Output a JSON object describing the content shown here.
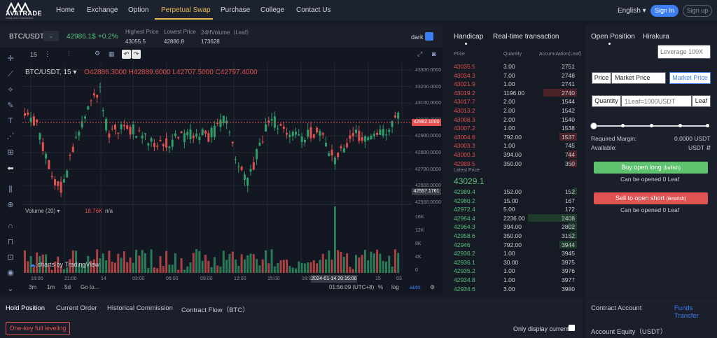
{
  "brand": {
    "name": "AVATRADE",
    "tagline": "TRADE WITH CONFIDENCE"
  },
  "nav": {
    "items": [
      "Home",
      "Exchange",
      "Option",
      "Perpetual Swap",
      "Purchase",
      "College",
      "Contact Us"
    ],
    "active_index": 3,
    "language": "English ▾",
    "signin": "Sign In",
    "signup": "Sign up"
  },
  "ticker": {
    "pair": "BTC/USDT",
    "price": "42986.1$",
    "change": "+0.2%",
    "highest_label": "Highest Price",
    "highest_value": "43055.5",
    "lowest_label": "Lowest Price",
    "lowest_value": "42886.8",
    "volume_label": "24HVolume（Leaf）",
    "volume_value": "173628",
    "theme_label": "dark"
  },
  "chart_toolbar": {
    "interval": "15"
  },
  "chart": {
    "symbol_line": "BTC/USDT, 15 ▾",
    "ohlc": "O42886.3000  H42889.6000  L42707.5000  C42797.4000",
    "y_ticks": [
      "43300.0000",
      "43200.0000",
      "43100.0000",
      "43000.0000",
      "42900.0000",
      "42800.0000",
      "42700.0000",
      "42600.0000",
      "42500.0000"
    ],
    "current_price_tag": "42982.1000",
    "low_tag": "42557.1761",
    "volume_label": "Volume (20) ▾",
    "volume_value": "18.76K",
    "volume_na": "n/a",
    "vol_ticks": [
      "16K",
      "12K",
      "8K",
      "4K",
      "0"
    ],
    "x_ticks": [
      "18:00",
      "21:00",
      "14",
      "03:00",
      "06:00",
      "09:00",
      "12:00",
      "15:00",
      "18:0",
      "15",
      "03"
    ],
    "highlight_time": "2024-01-14 20:15:00",
    "tradingview": "charts by TradingView",
    "ranges": [
      "3m",
      "1m",
      "5d",
      "Go to..."
    ],
    "clock": "01:56:09 (UTC+8)",
    "pct": "%",
    "log": "log",
    "auto": "auto",
    "colors": {
      "up": "#2f9e6a",
      "down": "#e0504f"
    }
  },
  "orderbook": {
    "tabs": [
      "Handicap",
      "Real-time transaction"
    ],
    "headers": [
      "Price",
      "Quantity",
      "Accumulation(Leaf)"
    ],
    "asks": [
      {
        "price": "43035.5",
        "qty": "3.00",
        "acc": "2751",
        "depth": 0.0
      },
      {
        "price": "43034.3",
        "qty": "7.00",
        "acc": "2748",
        "depth": 0.0
      },
      {
        "price": "43021.9",
        "qty": "1.00",
        "acc": "2741",
        "depth": 0.0
      },
      {
        "price": "43019.2",
        "qty": "1196.00",
        "acc": "2740",
        "depth": 0.68
      },
      {
        "price": "43017.7",
        "qty": "2.00",
        "acc": "1544",
        "depth": 0.0
      },
      {
        "price": "43013.2",
        "qty": "2.00",
        "acc": "1542",
        "depth": 0.0
      },
      {
        "price": "43008.3",
        "qty": "2.00",
        "acc": "1540",
        "depth": 0.0
      },
      {
        "price": "43007.2",
        "qty": "1.00",
        "acc": "1538",
        "depth": 0.0
      },
      {
        "price": "43004.6",
        "qty": "792.00",
        "acc": "1537",
        "depth": 0.36
      },
      {
        "price": "43003.3",
        "qty": "1.00",
        "acc": "745",
        "depth": 0.0
      },
      {
        "price": "43000.3",
        "qty": "394.00",
        "acc": "744",
        "depth": 0.18
      },
      {
        "price": "42989.5",
        "qty": "350.00",
        "acc": "350",
        "depth": 0.14
      }
    ],
    "latest_label": "Latest Price",
    "latest_value": "43029.1",
    "bids": [
      {
        "price": "42989.4",
        "qty": "152.00",
        "acc": "152",
        "depth": 0.08
      },
      {
        "price": "42980.2",
        "qty": "15.00",
        "acc": "167",
        "depth": 0.0
      },
      {
        "price": "42972.4",
        "qty": "5.00",
        "acc": "172",
        "depth": 0.0
      },
      {
        "price": "42964.4",
        "qty": "2236.00",
        "acc": "2408",
        "depth": 1.0
      },
      {
        "price": "42964.3",
        "qty": "394.00",
        "acc": "2802",
        "depth": 0.18
      },
      {
        "price": "42958.6",
        "qty": "350.00",
        "acc": "3152",
        "depth": 0.15
      },
      {
        "price": "42946",
        "qty": "792.00",
        "acc": "3944",
        "depth": 0.36
      },
      {
        "price": "42936.2",
        "qty": "1.00",
        "acc": "3945",
        "depth": 0.0
      },
      {
        "price": "42936.1",
        "qty": "30.00",
        "acc": "3975",
        "depth": 0.0
      },
      {
        "price": "42935.2",
        "qty": "1.00",
        "acc": "3976",
        "depth": 0.0
      },
      {
        "price": "42934.8",
        "qty": "1.00",
        "acc": "3977",
        "depth": 0.0
      },
      {
        "price": "42934.6",
        "qty": "3.00",
        "acc": "3980",
        "depth": 0.0
      }
    ]
  },
  "panel": {
    "tabs": [
      "Open Position",
      "Hirakura"
    ],
    "leverage_placeholder": "Leverage 100X",
    "price_label": "Price",
    "price_input": "Market Price",
    "market_price_btn": "Market Price",
    "quantity_label": "Quantity",
    "quantity_placeholder": "1Leaf=1000USDT",
    "unit_btn": "Leaf",
    "required_margin_label": "Required Margin:",
    "required_margin_value": "0.0000 USDT",
    "available_label": "Available:",
    "available_value": "USDT ⇵",
    "buy_label": "Buy open long",
    "buy_sub": "(bullish)",
    "buy_note": "Can be opened 0 Leaf",
    "sell_label": "Sell to open short",
    "sell_sub": "(Bearish)",
    "sell_note": "Can be opened 0 Leaf"
  },
  "bottom": {
    "tabs": [
      "Hold Position",
      "Current Order",
      "Historical Commission",
      "Contract Flow（BTC）"
    ],
    "one_key": "One-key full leveling",
    "only_display": "Only display current",
    "account_title": "Contract Account",
    "funds_transfer": "Funds Transfer",
    "equity_label": "Account Equity（USDT）"
  }
}
